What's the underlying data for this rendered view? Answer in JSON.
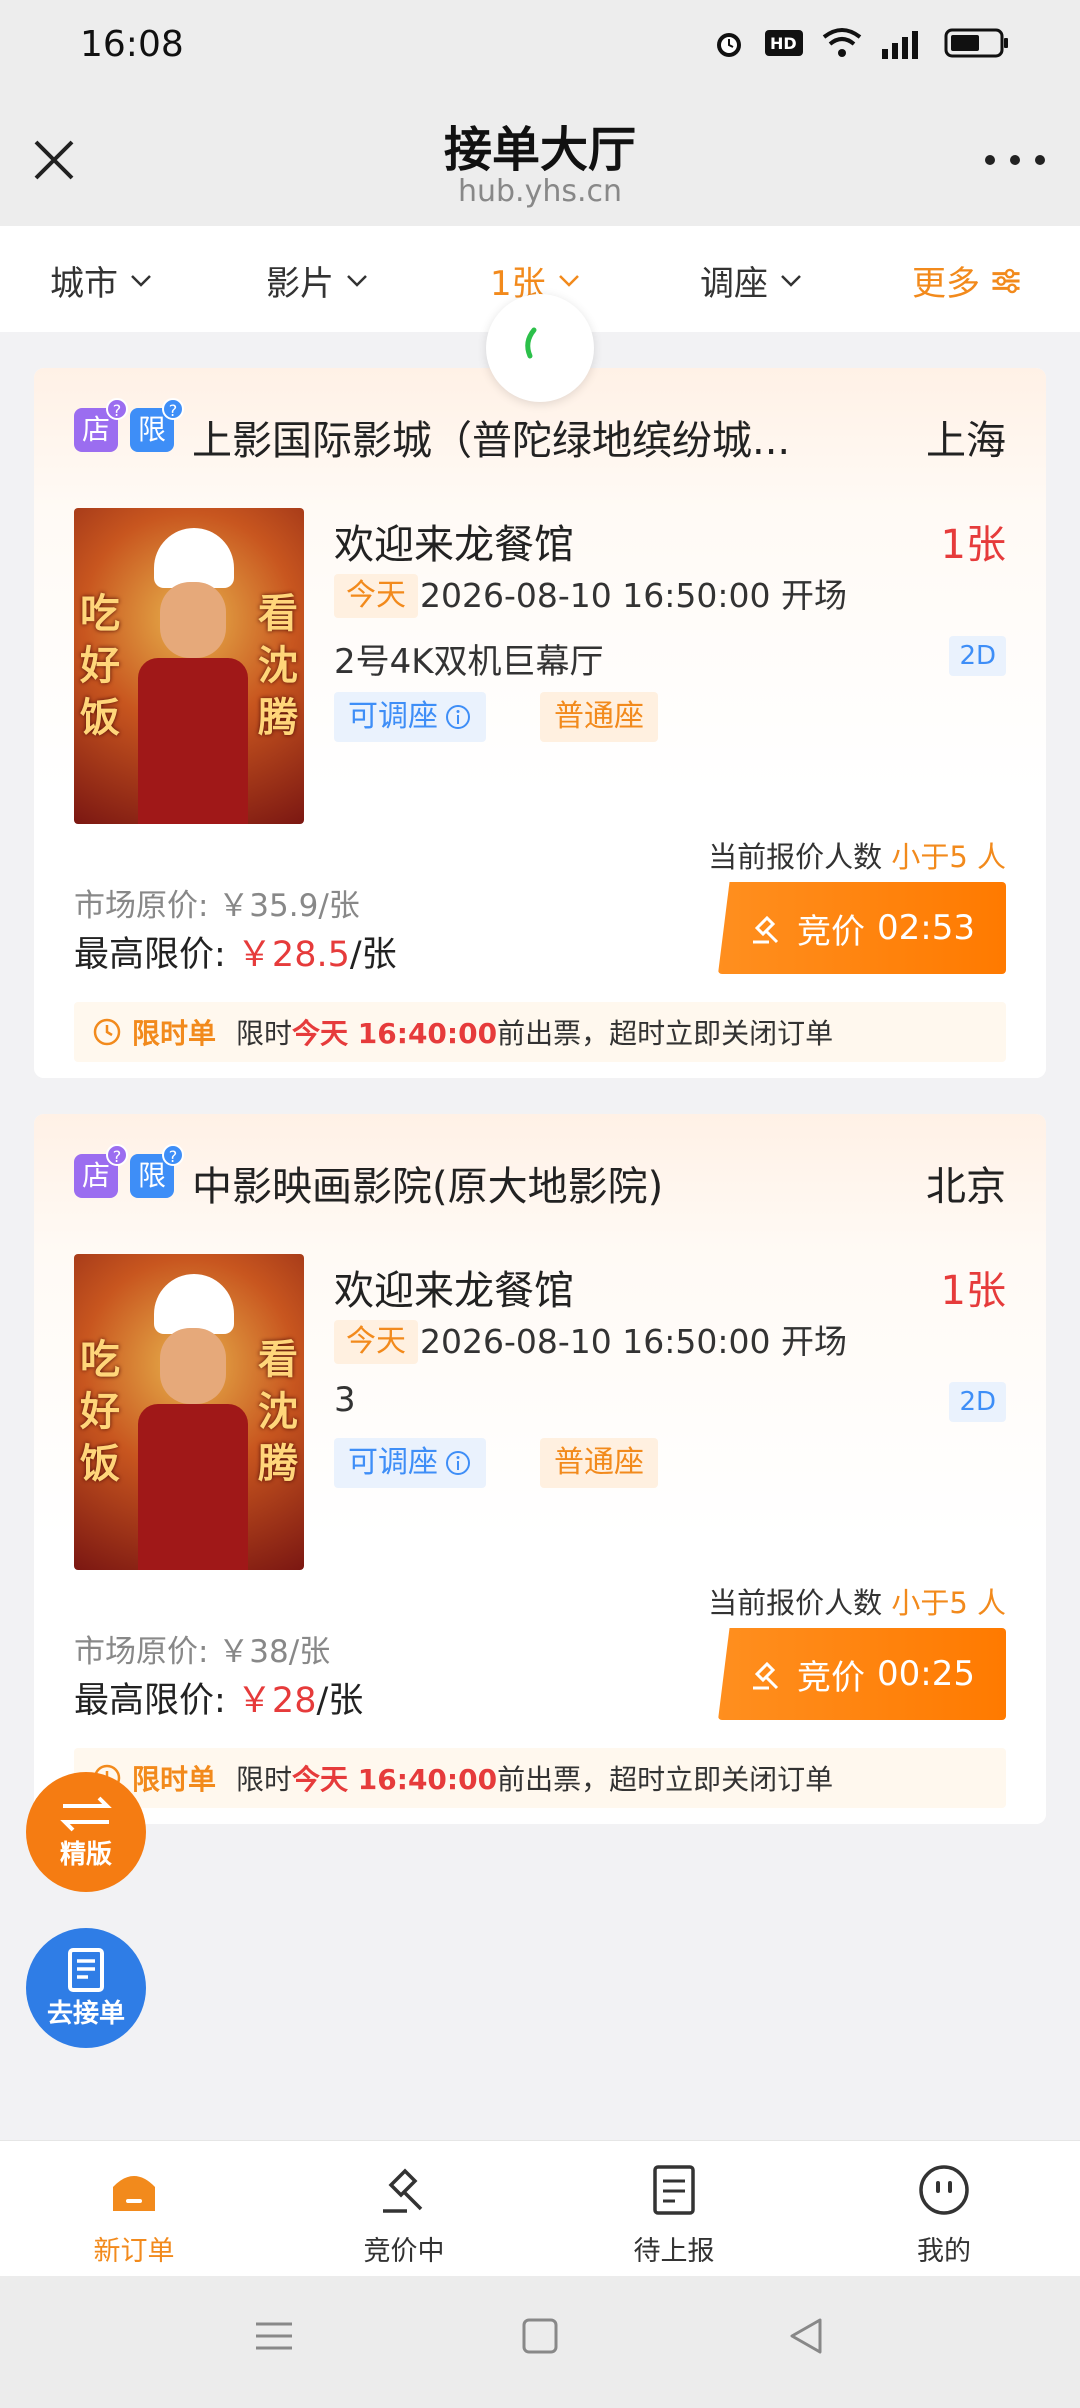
{
  "status_bar": {
    "time": "16:08"
  },
  "header": {
    "title": "接单大厅",
    "subtitle": "hub.yhs.cn"
  },
  "filters": [
    {
      "label": "城市"
    },
    {
      "label": "影片"
    },
    {
      "label": "1张"
    },
    {
      "label": "调座"
    },
    {
      "label": "更多"
    }
  ],
  "orders": [
    {
      "badge_store": "店",
      "badge_limit": "限",
      "badge_help": "?",
      "cinema": "上影国际影城（普陀绿地缤纷城...",
      "city": "上海",
      "poster_left": "吃好饭",
      "poster_right": "看沈腾",
      "movie": "欢迎来龙餐馆",
      "tickets": "1张",
      "today": "今天",
      "showtime": "2026-08-10 16:50:00 开场",
      "hall": "2号4K双机巨幕厅",
      "format": "2D",
      "tag_adjust": "可调座",
      "tag_normal": "普通座",
      "bid_count_prefix": "当前报价人数",
      "bid_count_value": "小于5 人",
      "market_price": "市场原价: ￥35.9/张",
      "max_price_label": "最高限价: ",
      "max_price_value": "￥28.5",
      "max_price_unit": "/张",
      "bid_label": "竞价",
      "bid_timer": "02:53",
      "notice_label": "限时单",
      "notice_prefix": "限时",
      "notice_time": "今天 16:40:00",
      "notice_suffix": "前出票，超时立即关闭订单"
    },
    {
      "badge_store": "店",
      "badge_limit": "限",
      "badge_help": "?",
      "cinema": "中影映画影院(原大地影院)",
      "city": "北京",
      "poster_left": "吃好饭",
      "poster_right": "看沈腾",
      "movie": "欢迎来龙餐馆",
      "tickets": "1张",
      "today": "今天",
      "showtime": "2026-08-10 16:50:00 开场",
      "hall": "3",
      "format": "2D",
      "tag_adjust": "可调座",
      "tag_normal": "普通座",
      "bid_count_prefix": "当前报价人数",
      "bid_count_value": "小于5 人",
      "market_price": "市场原价: ￥38/张",
      "max_price_label": "最高限价: ",
      "max_price_value": "￥28",
      "max_price_unit": "/张",
      "bid_label": "竞价",
      "bid_timer": "00:25",
      "notice_label": "限时单",
      "notice_prefix": "限时",
      "notice_time": "今天 16:40:00",
      "notice_suffix": "前出票，超时立即关闭订单"
    }
  ],
  "fabs": {
    "jingban": "精版",
    "go_orders": "去接单"
  },
  "bottom_nav": [
    {
      "label": "新订单",
      "icon": "home-icon"
    },
    {
      "label": "竞价中",
      "icon": "gavel-icon"
    },
    {
      "label": "待上报",
      "icon": "document-icon"
    },
    {
      "label": "我的",
      "icon": "profile-icon"
    }
  ],
  "colors": {
    "accent": "#f28a1c",
    "price_red": "#e63b3b",
    "blue": "#3e8ef7"
  }
}
